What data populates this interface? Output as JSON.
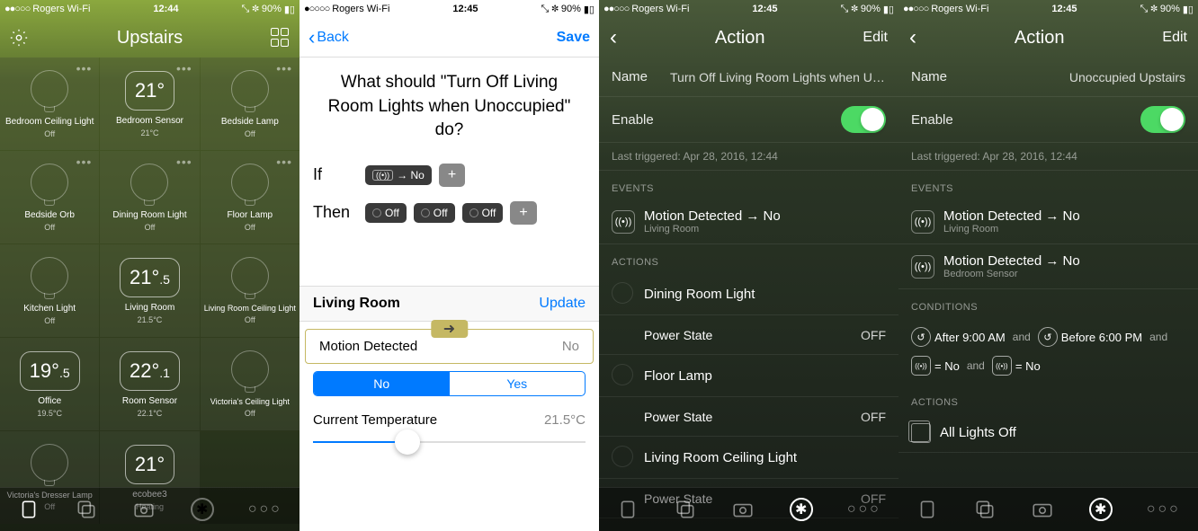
{
  "status": {
    "carrier": "Rogers Wi-Fi",
    "time1": "12:44",
    "time2": "12:45",
    "battery": "90%"
  },
  "s1": {
    "title": "Upstairs",
    "tiles": [
      {
        "name": "Bedroom Ceiling Light",
        "sub": "Off"
      },
      {
        "name": "Bedroom Sensor",
        "sub": "21°C",
        "temp": "21°"
      },
      {
        "name": "Bedside Lamp",
        "sub": "Off"
      },
      {
        "name": "Bedside Orb",
        "sub": "Off"
      },
      {
        "name": "Dining Room Light",
        "sub": "Off"
      },
      {
        "name": "Floor Lamp",
        "sub": "Off"
      },
      {
        "name": "Kitchen Light",
        "sub": "Off"
      },
      {
        "name": "Living Room",
        "sub": "21.5°C",
        "temp": "21°",
        "frac": ".5"
      },
      {
        "name": "Living Room Ceiling Light",
        "sub": "Off"
      },
      {
        "name": "Office",
        "sub": "19.5°C",
        "temp": "19°",
        "frac": ".5"
      },
      {
        "name": "Room Sensor",
        "sub": "22.1°C",
        "temp": "22°",
        "frac": ".1"
      },
      {
        "name": "Victoria's Ceiling Light",
        "sub": "Off"
      },
      {
        "name": "Victoria's Dresser Lamp",
        "sub": "Off"
      },
      {
        "name": "ecobee3",
        "sub": "Heating",
        "temp": "21°"
      }
    ]
  },
  "s2": {
    "back": "Back",
    "save": "Save",
    "question": "What should \"Turn Off Living Room Lights when Unoccupied\" do?",
    "if": "If",
    "then": "Then",
    "if_tag": "→ No",
    "then_tags": [
      "Off",
      "Off",
      "Off"
    ],
    "section_name": "Living Room",
    "update": "Update",
    "motion_label": "Motion Detected",
    "motion_value": "No",
    "seg_no": "No",
    "seg_yes": "Yes",
    "temp_label": "Current Temperature",
    "temp_value": "21.5°C"
  },
  "s3": {
    "title": "Action",
    "edit": "Edit",
    "name_lbl": "Name",
    "name_val": "Turn Off Living Room Lights when Unoccup…",
    "enable": "Enable",
    "last": "Last triggered: Apr 28, 2016, 12:44",
    "events_hdr": "EVENTS",
    "event_title": "Motion Detected → No",
    "event_sub": "Living Room",
    "actions_hdr": "ACTIONS",
    "actions": [
      {
        "name": "Dining Room Light",
        "state": "Power State",
        "val": "OFF"
      },
      {
        "name": "Floor Lamp",
        "state": "Power State",
        "val": "OFF"
      },
      {
        "name": "Living Room Ceiling Light",
        "state": "Power State",
        "val": "OFF"
      }
    ]
  },
  "s4": {
    "title": "Action",
    "edit": "Edit",
    "name_lbl": "Name",
    "name_val": "Unoccupied Upstairs",
    "enable": "Enable",
    "last": "Last triggered: Apr 28, 2016, 12:44",
    "events_hdr": "EVENTS",
    "events": [
      {
        "t": "Motion Detected → No",
        "s": "Living Room"
      },
      {
        "t": "Motion Detected → No",
        "s": "Bedroom Sensor"
      }
    ],
    "cond_hdr": "CONDITIONS",
    "cond_after": "After 9:00 AM",
    "cond_before": "Before 6:00 PM",
    "cond_eq": "= No",
    "and": "and",
    "actions_hdr": "ACTIONS",
    "scene": "All Lights Off"
  }
}
